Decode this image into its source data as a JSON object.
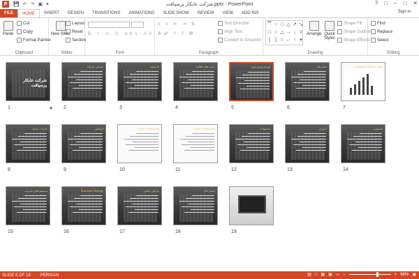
{
  "window": {
    "title": "شرکت عابکار پرسپافت.pptx - PowerPoint",
    "signin": "Sign in",
    "app_icon_letter": "P"
  },
  "tabs": [
    {
      "label": "FILE"
    },
    {
      "label": "HOME"
    },
    {
      "label": "INSERT"
    },
    {
      "label": "DESIGN"
    },
    {
      "label": "TRANSITIONS"
    },
    {
      "label": "ANIMATIONS"
    },
    {
      "label": "SLIDE SHOW"
    },
    {
      "label": "REVIEW"
    },
    {
      "label": "VIEW"
    },
    {
      "label": "ADD-INS"
    }
  ],
  "ribbon": {
    "clipboard": {
      "label": "Clipboard",
      "paste": "Paste",
      "cut": "Cut",
      "copy": "Copy",
      "format_painter": "Format Painter"
    },
    "slides": {
      "label": "Slides",
      "new_slide": "New Slide",
      "layout": "Layout",
      "reset": "Reset",
      "section": "Section"
    },
    "font": {
      "label": "Font"
    },
    "paragraph": {
      "label": "Paragraph",
      "text_direction": "Text Direction",
      "align_text": "Align Text",
      "convert_smartart": "Convert to SmartArt"
    },
    "drawing": {
      "label": "Drawing",
      "arrange": "Arrange",
      "quick_styles": "Quick Styles",
      "shape_fill": "Shape Fill",
      "shape_outline": "Shape Outline",
      "shape_effects": "Shape Effects"
    },
    "editing": {
      "label": "Editing",
      "find": "Find",
      "replace": "Replace",
      "select": "Select"
    }
  },
  "slides": [
    {
      "num": "1",
      "title": "",
      "big": "شرکت عابکار پرسپافت",
      "type": "title"
    },
    {
      "num": "2",
      "title": "معرفی شرکت",
      "type": "text"
    },
    {
      "num": "3",
      "title": "تاریخچه",
      "type": "text"
    },
    {
      "num": "4",
      "title": "زمینه های فعالیت",
      "type": "text"
    },
    {
      "num": "5",
      "title": "ISO 9001:2008",
      "type": "text"
    },
    {
      "num": "6",
      "title": "مشتریان",
      "type": "text"
    },
    {
      "num": "7",
      "title": "Windows Server 2008",
      "type": "chart"
    },
    {
      "num": "8",
      "title": "خدمات شبکه",
      "type": "text"
    },
    {
      "num": "9",
      "title": "لینوکس",
      "type": "text"
    },
    {
      "num": "10",
      "title": "Linux & Windows",
      "type": "table"
    },
    {
      "num": "11",
      "title": "Linux & Windows",
      "type": "table"
    },
    {
      "num": "12",
      "title": "محصولات",
      "type": "image"
    },
    {
      "num": "13",
      "title": "آموزش",
      "type": "text"
    },
    {
      "num": "14",
      "title": "پشتیبانی",
      "type": "text"
    },
    {
      "num": "15",
      "title": "سیستم های مدیریت",
      "type": "text"
    },
    {
      "num": "16",
      "title": "Business Strategy",
      "type": "text"
    },
    {
      "num": "17",
      "title": "مزایای رقابتی",
      "type": "text"
    },
    {
      "num": "18",
      "title": "چشم انداز",
      "type": "text"
    },
    {
      "num": "19",
      "title": "",
      "type": "laptop"
    }
  ],
  "selected_slide": "5",
  "status": {
    "slide_of": "SLIDE 5 OF 19",
    "language": "PERSIAN",
    "zoom": "68%",
    "zoom_fraction": 0.68
  }
}
